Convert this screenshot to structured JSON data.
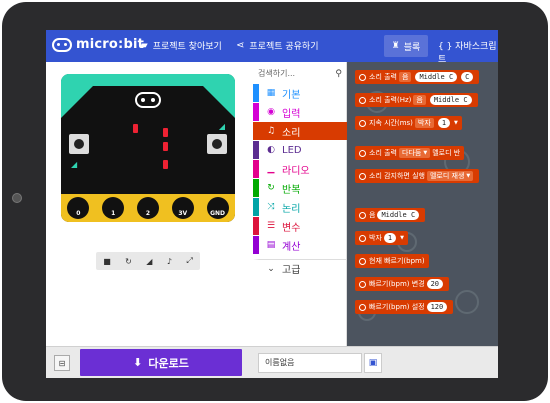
{
  "header": {
    "logo_text": "micro:bit",
    "explore_label": "프로젝트 찾아보기",
    "share_label": "프로젝트 공유하기",
    "blocks_label": "블록",
    "javascript_label": "{ } 자바스크립트"
  },
  "toolbox": {
    "search_placeholder": "검색하기...",
    "categories": [
      {
        "label": "기본",
        "color": "#1e90ff"
      },
      {
        "label": "입력",
        "color": "#d400d4"
      },
      {
        "label": "소리",
        "color": "#d83b01"
      },
      {
        "label": "LED",
        "color": "#5c2d91"
      },
      {
        "label": "라디오",
        "color": "#e3008c"
      },
      {
        "label": "반복",
        "color": "#00aa00"
      },
      {
        "label": "논리",
        "color": "#00a4a6"
      },
      {
        "label": "변수",
        "color": "#dc143c"
      },
      {
        "label": "계산",
        "color": "#9400d3"
      },
      {
        "label": "고급",
        "color": "#3c3c3c"
      }
    ]
  },
  "workspace": {
    "blocks": [
      {
        "prefix": "소리 출력",
        "inner": "음",
        "value": "Middle C",
        "tail": "C"
      },
      {
        "prefix": "소리 출력(Hz)",
        "inner": "음",
        "value": "Middle C",
        "tail": ""
      },
      {
        "prefix": "지속 시간(ms)",
        "inner": "박자",
        "value": "1",
        "tail": ""
      },
      {
        "prefix": "소리 출력",
        "inner": "다다둠",
        "value": "",
        "tail": "멜로디 반"
      },
      {
        "prefix": "소리 감지하면 실행",
        "inner": "멜로디 재생",
        "value": "",
        "tail": ""
      },
      {
        "prefix": "음",
        "inner": "",
        "value": "Middle C",
        "tail": ""
      },
      {
        "prefix": "박자",
        "inner": "",
        "value": "1",
        "tail": ""
      },
      {
        "prefix": "현재 빠르기(bpm)",
        "inner": "",
        "value": "",
        "tail": ""
      },
      {
        "prefix": "빠르기(bpm) 변경",
        "inner": "",
        "value": "20",
        "tail": ""
      },
      {
        "prefix": "빠르기(bpm) 설정",
        "inner": "",
        "value": "120",
        "tail": ""
      }
    ]
  },
  "simulator": {
    "pins": [
      "0",
      "1",
      "2",
      "3V",
      "GND"
    ],
    "controls": [
      "■",
      "↻",
      "◢",
      "♪",
      "⤢"
    ]
  },
  "footer": {
    "download_label": "다운로드",
    "project_name": "이름없음"
  },
  "colors": {
    "header_blue": "#3454d1",
    "sound_orange": "#d83b01",
    "download_purple": "#6b2fd4",
    "board_teal": "#2fd3b0",
    "board_gold": "#f0c020"
  }
}
